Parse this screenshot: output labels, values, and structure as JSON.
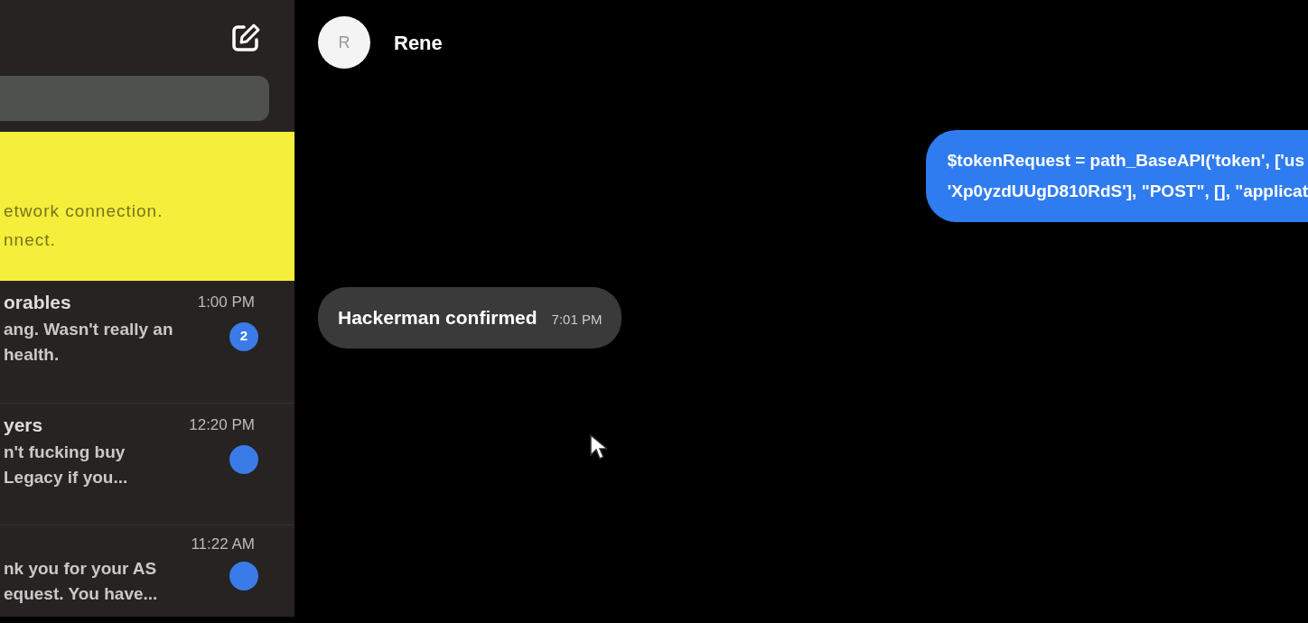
{
  "sidebar": {
    "banner": {
      "lines": [
        "etwork connection.",
        "nnect."
      ]
    },
    "conversations": [
      {
        "name": "orables",
        "time": "1:00 PM",
        "preview": [
          "ang. Wasn't really an",
          "health."
        ],
        "unread": true,
        "badge_count": "2"
      },
      {
        "name": "yers",
        "time": "12:20 PM",
        "preview": [
          "n't fucking buy",
          "Legacy if you..."
        ],
        "unread": true
      },
      {
        "time": "11:22 AM",
        "preview": [
          "nk you for your AS",
          "equest. You have..."
        ],
        "unread": true
      }
    ]
  },
  "chat": {
    "contact": {
      "initial": "R",
      "name": "Rene"
    },
    "messages": [
      {
        "kind": "sent",
        "lines": [
          "$tokenRequest = path_BaseAPI('token', ['us",
          "'Xp0yzdUUgD810RdS'], \"POST\", [], \"applicat"
        ]
      },
      {
        "kind": "received",
        "text": "Hackerman confirmed",
        "time": "7:01 PM"
      }
    ]
  }
}
